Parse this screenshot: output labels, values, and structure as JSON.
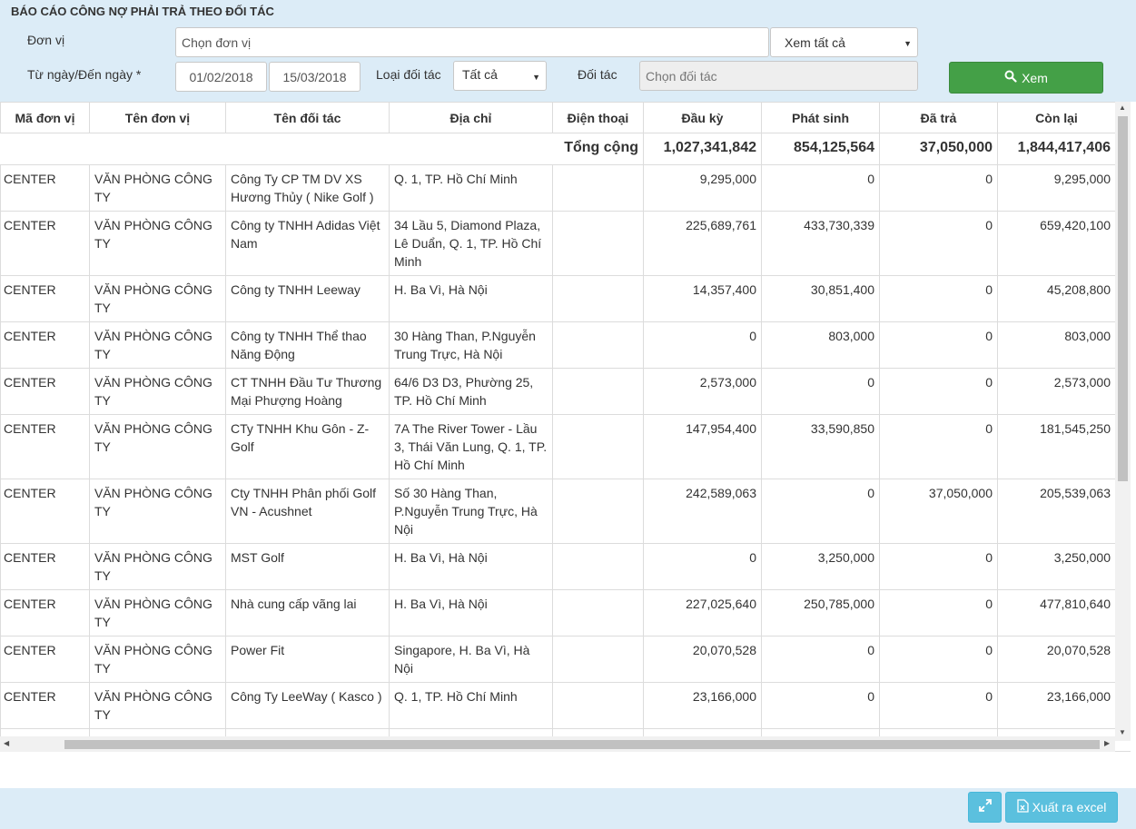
{
  "title": "BÁO CÁO CÔNG NỢ PHẢI TRẢ THEO ĐỐI TÁC",
  "filters": {
    "unit_label": "Đơn vị",
    "unit_placeholder": "Chọn đơn vị",
    "view_select": "Xem tất cả",
    "date_label": "Từ ngày/Đến ngày *",
    "from_date": "01/02/2018",
    "to_date": "15/03/2018",
    "partner_type_label": "Loại đối tác",
    "partner_type_value": "Tất cả",
    "partner_label": "Đối tác",
    "partner_placeholder": "Chọn đối tác",
    "view_button": "Xem"
  },
  "table": {
    "columns": [
      "Mã đơn vị",
      "Tên đơn vị",
      "Tên đối tác",
      "Địa chỉ",
      "Điện thoại",
      "Đầu kỳ",
      "Phát sinh",
      "Đã trả",
      "Còn lại"
    ],
    "total": {
      "label": "Tổng cộng",
      "dau_ky": "1,027,341,842",
      "phat_sinh": "854,125,564",
      "da_tra": "37,050,000",
      "con_lai": "1,844,417,406"
    },
    "rows": [
      {
        "ma": "CENTER",
        "ten_dv": "VĂN PHÒNG CÔNG TY",
        "doi_tac": "Công Ty CP TM DV XS Hương Thủy ( Nike Golf )",
        "dia_chi": "Q. 1, TP. Hồ Chí Minh",
        "dt": "",
        "dau_ky": "9,295,000",
        "phat_sinh": "0",
        "da_tra": "0",
        "con_lai": "9,295,000"
      },
      {
        "ma": "CENTER",
        "ten_dv": "VĂN PHÒNG CÔNG TY",
        "doi_tac": "Công ty TNHH Adidas Việt Nam",
        "dia_chi": "34 Lầu 5, Diamond Plaza, Lê Duẩn, Q. 1, TP. Hồ Chí Minh",
        "dt": "",
        "dau_ky": "225,689,761",
        "phat_sinh": "433,730,339",
        "da_tra": "0",
        "con_lai": "659,420,100"
      },
      {
        "ma": "CENTER",
        "ten_dv": "VĂN PHÒNG CÔNG TY",
        "doi_tac": "Công ty TNHH Leeway",
        "dia_chi": "H. Ba Vì, Hà Nội",
        "dt": "",
        "dau_ky": "14,357,400",
        "phat_sinh": "30,851,400",
        "da_tra": "0",
        "con_lai": "45,208,800"
      },
      {
        "ma": "CENTER",
        "ten_dv": "VĂN PHÒNG CÔNG TY",
        "doi_tac": "Công ty TNHH Thể thao Năng Động",
        "dia_chi": "30 Hàng Than, P.Nguyễn Trung Trực, Hà Nội",
        "dt": "",
        "dau_ky": "0",
        "phat_sinh": "803,000",
        "da_tra": "0",
        "con_lai": "803,000"
      },
      {
        "ma": "CENTER",
        "ten_dv": "VĂN PHÒNG CÔNG TY",
        "doi_tac": "CT TNHH Đầu Tư Thương Mại Phượng Hoàng",
        "dia_chi": "64/6 D3 D3, Phường 25, TP. Hồ Chí Minh",
        "dt": "",
        "dau_ky": "2,573,000",
        "phat_sinh": "0",
        "da_tra": "0",
        "con_lai": "2,573,000"
      },
      {
        "ma": "CENTER",
        "ten_dv": "VĂN PHÒNG CÔNG TY",
        "doi_tac": "CTy TNHH Khu Gôn - Z-Golf",
        "dia_chi": "7A The River Tower - Lầu 3, Thái Văn Lung, Q. 1, TP. Hồ Chí Minh",
        "dt": "",
        "dau_ky": "147,954,400",
        "phat_sinh": "33,590,850",
        "da_tra": "0",
        "con_lai": "181,545,250"
      },
      {
        "ma": "CENTER",
        "ten_dv": "VĂN PHÒNG CÔNG TY",
        "doi_tac": "Cty TNHH Phân phối Golf VN - Acushnet",
        "dia_chi": "Số 30 Hàng Than, P.Nguyễn Trung Trực, Hà Nội",
        "dt": "",
        "dau_ky": "242,589,063",
        "phat_sinh": "0",
        "da_tra": "37,050,000",
        "con_lai": "205,539,063"
      },
      {
        "ma": "CENTER",
        "ten_dv": "VĂN PHÒNG CÔNG TY",
        "doi_tac": "MST Golf",
        "dia_chi": "H. Ba Vì, Hà Nội",
        "dt": "",
        "dau_ky": "0",
        "phat_sinh": "3,250,000",
        "da_tra": "0",
        "con_lai": "3,250,000"
      },
      {
        "ma": "CENTER",
        "ten_dv": "VĂN PHÒNG CÔNG TY",
        "doi_tac": "Nhà cung cấp vãng lai",
        "dia_chi": "H. Ba Vì, Hà Nội",
        "dt": "",
        "dau_ky": "227,025,640",
        "phat_sinh": "250,785,000",
        "da_tra": "0",
        "con_lai": "477,810,640"
      },
      {
        "ma": "CENTER",
        "ten_dv": "VĂN PHÒNG CÔNG TY",
        "doi_tac": "Power Fit",
        "dia_chi": "Singapore, H. Ba Vì, Hà Nội",
        "dt": "",
        "dau_ky": "20,070,528",
        "phat_sinh": "0",
        "da_tra": "0",
        "con_lai": "20,070,528"
      },
      {
        "ma": "CENTER",
        "ten_dv": "VĂN PHÒNG CÔNG TY",
        "doi_tac": "Công Ty LeeWay ( Kasco )",
        "dia_chi": "Q. 1, TP. Hồ Chí Minh",
        "dt": "",
        "dau_ky": "23,166,000",
        "phat_sinh": "0",
        "da_tra": "0",
        "con_lai": "23,166,000"
      },
      {
        "ma": "",
        "ten_dv": "",
        "doi_tac": "",
        "dia_chi": "",
        "dt": "",
        "dau_ky": "",
        "phat_sinh": "",
        "da_tra": "",
        "con_lai": ""
      }
    ]
  },
  "footer": {
    "export_button": "Xuất ra excel"
  },
  "icons": {
    "search": "search-icon",
    "expand": "expand-icon",
    "excel": "file-excel-icon"
  },
  "colors": {
    "panel_bg": "#dcecf7",
    "primary_green": "#44a047",
    "info_blue": "#5bc0de"
  }
}
